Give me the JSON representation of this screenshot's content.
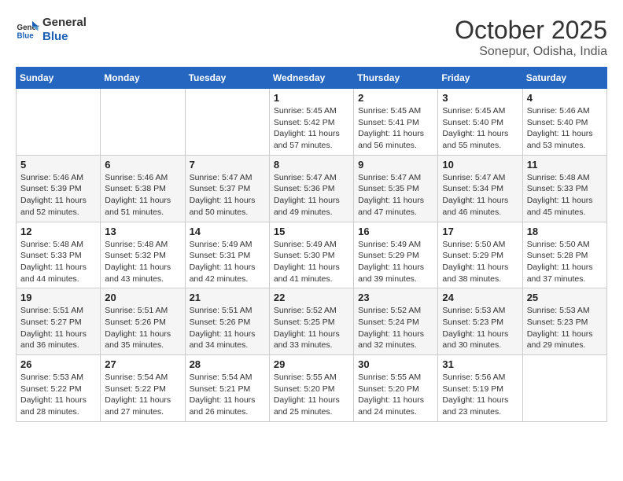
{
  "logo": {
    "line1": "General",
    "line2": "Blue"
  },
  "title": "October 2025",
  "subtitle": "Sonepur, Odisha, India",
  "weekdays": [
    "Sunday",
    "Monday",
    "Tuesday",
    "Wednesday",
    "Thursday",
    "Friday",
    "Saturday"
  ],
  "weeks": [
    [
      {
        "day": "",
        "info": ""
      },
      {
        "day": "",
        "info": ""
      },
      {
        "day": "",
        "info": ""
      },
      {
        "day": "1",
        "info": "Sunrise: 5:45 AM\nSunset: 5:42 PM\nDaylight: 11 hours\nand 57 minutes."
      },
      {
        "day": "2",
        "info": "Sunrise: 5:45 AM\nSunset: 5:41 PM\nDaylight: 11 hours\nand 56 minutes."
      },
      {
        "day": "3",
        "info": "Sunrise: 5:45 AM\nSunset: 5:40 PM\nDaylight: 11 hours\nand 55 minutes."
      },
      {
        "day": "4",
        "info": "Sunrise: 5:46 AM\nSunset: 5:40 PM\nDaylight: 11 hours\nand 53 minutes."
      }
    ],
    [
      {
        "day": "5",
        "info": "Sunrise: 5:46 AM\nSunset: 5:39 PM\nDaylight: 11 hours\nand 52 minutes."
      },
      {
        "day": "6",
        "info": "Sunrise: 5:46 AM\nSunset: 5:38 PM\nDaylight: 11 hours\nand 51 minutes."
      },
      {
        "day": "7",
        "info": "Sunrise: 5:47 AM\nSunset: 5:37 PM\nDaylight: 11 hours\nand 50 minutes."
      },
      {
        "day": "8",
        "info": "Sunrise: 5:47 AM\nSunset: 5:36 PM\nDaylight: 11 hours\nand 49 minutes."
      },
      {
        "day": "9",
        "info": "Sunrise: 5:47 AM\nSunset: 5:35 PM\nDaylight: 11 hours\nand 47 minutes."
      },
      {
        "day": "10",
        "info": "Sunrise: 5:47 AM\nSunset: 5:34 PM\nDaylight: 11 hours\nand 46 minutes."
      },
      {
        "day": "11",
        "info": "Sunrise: 5:48 AM\nSunset: 5:33 PM\nDaylight: 11 hours\nand 45 minutes."
      }
    ],
    [
      {
        "day": "12",
        "info": "Sunrise: 5:48 AM\nSunset: 5:33 PM\nDaylight: 11 hours\nand 44 minutes."
      },
      {
        "day": "13",
        "info": "Sunrise: 5:48 AM\nSunset: 5:32 PM\nDaylight: 11 hours\nand 43 minutes."
      },
      {
        "day": "14",
        "info": "Sunrise: 5:49 AM\nSunset: 5:31 PM\nDaylight: 11 hours\nand 42 minutes."
      },
      {
        "day": "15",
        "info": "Sunrise: 5:49 AM\nSunset: 5:30 PM\nDaylight: 11 hours\nand 41 minutes."
      },
      {
        "day": "16",
        "info": "Sunrise: 5:49 AM\nSunset: 5:29 PM\nDaylight: 11 hours\nand 39 minutes."
      },
      {
        "day": "17",
        "info": "Sunrise: 5:50 AM\nSunset: 5:29 PM\nDaylight: 11 hours\nand 38 minutes."
      },
      {
        "day": "18",
        "info": "Sunrise: 5:50 AM\nSunset: 5:28 PM\nDaylight: 11 hours\nand 37 minutes."
      }
    ],
    [
      {
        "day": "19",
        "info": "Sunrise: 5:51 AM\nSunset: 5:27 PM\nDaylight: 11 hours\nand 36 minutes."
      },
      {
        "day": "20",
        "info": "Sunrise: 5:51 AM\nSunset: 5:26 PM\nDaylight: 11 hours\nand 35 minutes."
      },
      {
        "day": "21",
        "info": "Sunrise: 5:51 AM\nSunset: 5:26 PM\nDaylight: 11 hours\nand 34 minutes."
      },
      {
        "day": "22",
        "info": "Sunrise: 5:52 AM\nSunset: 5:25 PM\nDaylight: 11 hours\nand 33 minutes."
      },
      {
        "day": "23",
        "info": "Sunrise: 5:52 AM\nSunset: 5:24 PM\nDaylight: 11 hours\nand 32 minutes."
      },
      {
        "day": "24",
        "info": "Sunrise: 5:53 AM\nSunset: 5:23 PM\nDaylight: 11 hours\nand 30 minutes."
      },
      {
        "day": "25",
        "info": "Sunrise: 5:53 AM\nSunset: 5:23 PM\nDaylight: 11 hours\nand 29 minutes."
      }
    ],
    [
      {
        "day": "26",
        "info": "Sunrise: 5:53 AM\nSunset: 5:22 PM\nDaylight: 11 hours\nand 28 minutes."
      },
      {
        "day": "27",
        "info": "Sunrise: 5:54 AM\nSunset: 5:22 PM\nDaylight: 11 hours\nand 27 minutes."
      },
      {
        "day": "28",
        "info": "Sunrise: 5:54 AM\nSunset: 5:21 PM\nDaylight: 11 hours\nand 26 minutes."
      },
      {
        "day": "29",
        "info": "Sunrise: 5:55 AM\nSunset: 5:20 PM\nDaylight: 11 hours\nand 25 minutes."
      },
      {
        "day": "30",
        "info": "Sunrise: 5:55 AM\nSunset: 5:20 PM\nDaylight: 11 hours\nand 24 minutes."
      },
      {
        "day": "31",
        "info": "Sunrise: 5:56 AM\nSunset: 5:19 PM\nDaylight: 11 hours\nand 23 minutes."
      },
      {
        "day": "",
        "info": ""
      }
    ]
  ]
}
